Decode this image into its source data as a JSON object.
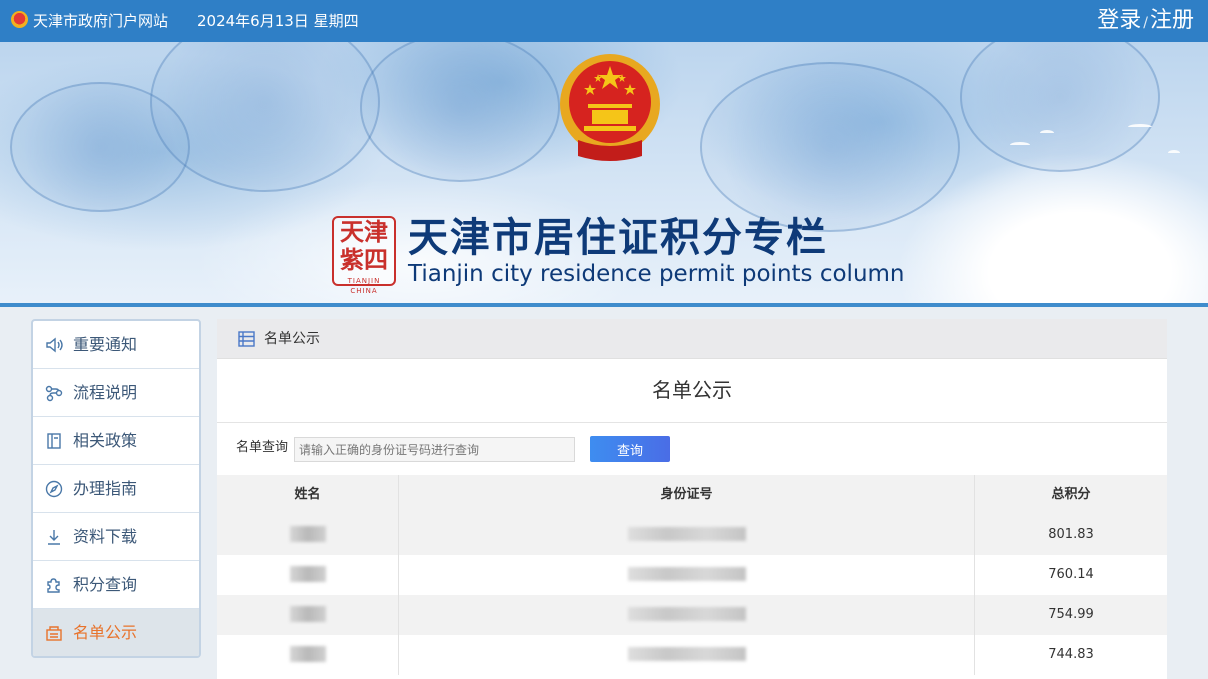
{
  "topbar": {
    "site_name": "天津市政府门户网站",
    "date": "2024年6月13日 星期四",
    "login": "登录",
    "separator": "/",
    "register": "注册"
  },
  "banner": {
    "title_cn": "天津市居住证积分专栏",
    "title_en": "Tianjin city residence permit points column",
    "seal_text_1": "天津",
    "seal_text_2": "紫四",
    "seal_sub": "TIANJIN CHINA"
  },
  "sidebar": {
    "items": [
      {
        "label": "重要通知",
        "icon": "speaker-icon"
      },
      {
        "label": "流程说明",
        "icon": "flow-icon"
      },
      {
        "label": "相关政策",
        "icon": "book-icon"
      },
      {
        "label": "办理指南",
        "icon": "compass-icon"
      },
      {
        "label": "资料下载",
        "icon": "download-icon"
      },
      {
        "label": "积分查询",
        "icon": "puzzle-icon"
      },
      {
        "label": "名单公示",
        "icon": "list-board-icon",
        "active": true
      }
    ]
  },
  "main": {
    "breadcrumb": "名单公示",
    "title": "名单公示",
    "query_label": "名单查询",
    "query_placeholder": "请输入正确的身份证号码进行查询",
    "query_button": "查询",
    "table": {
      "headers": [
        "姓名",
        "身份证号",
        "总积分"
      ],
      "rows": [
        {
          "name": "",
          "id": "",
          "score": "801.83"
        },
        {
          "name": "",
          "id": "",
          "score": "760.14"
        },
        {
          "name": "",
          "id": "",
          "score": "754.99"
        },
        {
          "name": "",
          "id": "",
          "score": "744.83"
        }
      ]
    }
  },
  "colors": {
    "topbar": "#2f7fc6",
    "active_nav": "#e8732c",
    "title_navy": "#0e3a78",
    "button": "#4a6de6"
  }
}
